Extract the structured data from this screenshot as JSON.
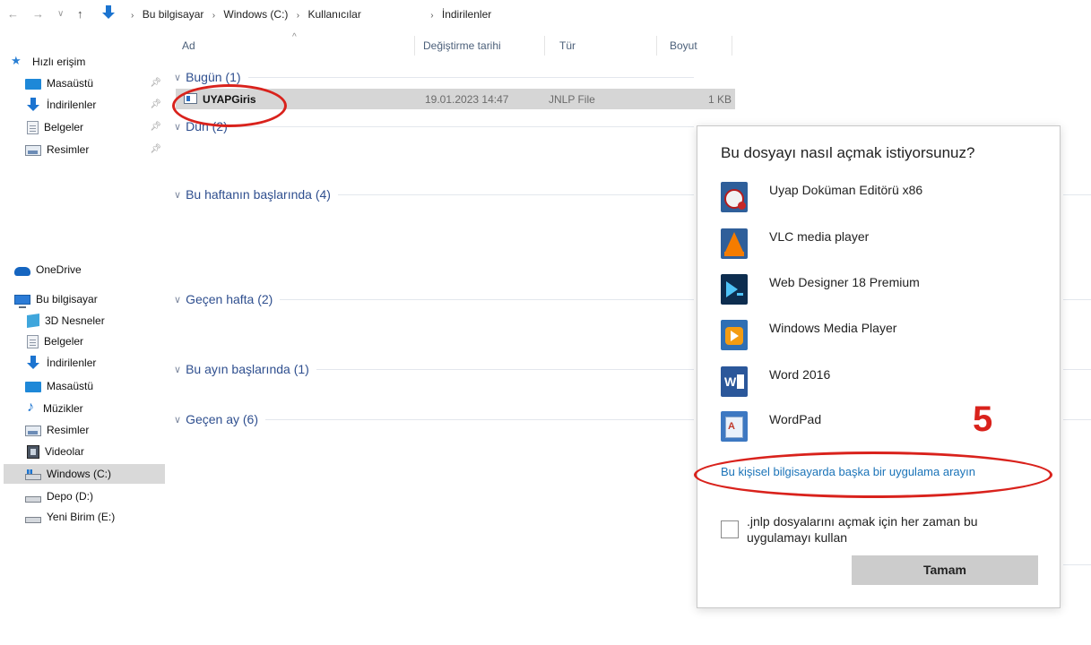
{
  "address_bar": {
    "crumbs": [
      "Bu bilgisayar",
      "Windows (C:)",
      "Kullanıcılar",
      "İndirilenler"
    ]
  },
  "sidebar": {
    "quick_access": "Hızlı erişim",
    "quick_items": [
      "Masaüstü",
      "İndirilenler",
      "Belgeler",
      "Resimler"
    ],
    "onedrive": "OneDrive",
    "this_pc": "Bu bilgisayar",
    "pc_items": [
      "3D Nesneler",
      "Belgeler",
      "İndirilenler",
      "Masaüstü",
      "Müzikler",
      "Resimler",
      "Videolar",
      "Windows (C:)",
      "Depo (D:)",
      "Yeni Birim (E:)"
    ]
  },
  "columns": {
    "name": "Ad",
    "date": "Değiştirme tarihi",
    "type": "Tür",
    "size": "Boyut"
  },
  "groups": {
    "today": "Bugün (1)",
    "yesterday": "Dün (2)",
    "this_week": "Bu haftanın başlarında (4)",
    "last_week": "Geçen hafta (2)",
    "this_month": "Bu ayın başlarında (1)",
    "last_month": "Geçen ay (6)"
  },
  "file": {
    "name": "UYAPGiris",
    "date": "19.01.2023 14:47",
    "type": "JNLP File",
    "size": "1 KB"
  },
  "dialog": {
    "title": "Bu dosyayı nasıl açmak istiyorsunuz?",
    "apps": [
      {
        "label": "Uyap Doküman Editörü x86",
        "icon": "uyap-icon"
      },
      {
        "label": "VLC media player",
        "icon": "vlc-icon"
      },
      {
        "label": "Web Designer 18 Premium",
        "icon": "web-designer-icon"
      },
      {
        "label": "Windows Media Player",
        "icon": "media-player-icon"
      },
      {
        "label": "Word 2016",
        "icon": "word-icon"
      },
      {
        "label": "WordPad",
        "icon": "wordpad-icon"
      }
    ],
    "link": "Bu kişisel bilgisayarda başka bir uygulama arayın",
    "checkbox_label": ".jnlp dosyalarını açmak için her zaman bu uygulamayı kullan",
    "ok_button": "Tamam"
  },
  "annotation": {
    "step_number": "5",
    "color": "#d9221c"
  }
}
